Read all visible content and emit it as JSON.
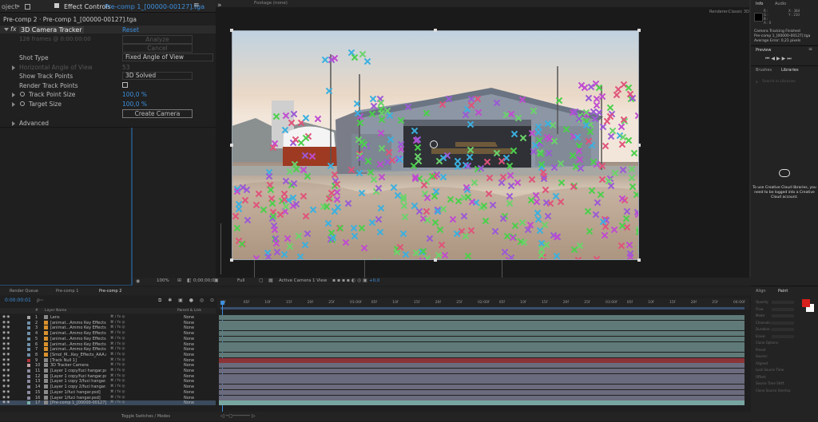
{
  "left_panel": {
    "project_tab": "oject",
    "effect_controls_label": "Effect Controls",
    "effect_controls_comp": "Pre-comp 1_[00000-00127].tga",
    "menu_glyph": "≡",
    "breadcrumb": "Pre-comp 2 · Pre-comp 1_[00000-00127].tga",
    "fx": "fx",
    "effect_name": "3D Camera Tracker",
    "reset": "Reset",
    "frames_info": "128 frames @ 0:00:00:00",
    "analyze_btn": "Analyze",
    "cancel_btn": "Cancel",
    "rows": [
      {
        "label": "Shot Type",
        "value": "Fixed Angle of View"
      },
      {
        "label": "Horizontal Angle of View",
        "value": "53"
      },
      {
        "label": "Show Track Points",
        "value": "3D Solved"
      },
      {
        "label": "Render Track Points",
        "value": ""
      },
      {
        "label": "Track Point Size",
        "value": "100,0 %"
      },
      {
        "label": "Target Size",
        "value": "100,0 %"
      }
    ],
    "create_camera": "Create Camera",
    "advanced": "Advanced"
  },
  "viewer": {
    "footage_tab": "Footage (none)",
    "renderer_label": "Renderer:",
    "renderer_value": "Classic 3D",
    "toolbar": {
      "zoom": "100%",
      "timecode": "0;00;00;01",
      "quality": "Full",
      "camera": "Active Camera",
      "views": "1 View",
      "offset": "+0,0"
    }
  },
  "info_panel": {
    "tab_info": "Info",
    "tab_audio": "Audio",
    "r": "R :",
    "g": "G :",
    "b": "B :",
    "a": "A : 0",
    "x": "X : 384",
    "y": "Y : 210",
    "status_lines": [
      "Camera Tracking Finished",
      "Pre-comp 1_[00000-00127].tga",
      "Average Error: 0,21 pixels"
    ]
  },
  "preview_panel": {
    "title": "Preview",
    "menu": "≡"
  },
  "libraries_panel": {
    "tab_brushes": "Brushes",
    "tab_libraries": "Libraries",
    "search_placeholder": "Search in Libraries",
    "message": "To use Creative Cloud libraries, you need to be logged into a Creative Cloud account."
  },
  "paint_panel": {
    "tab_align": "Align",
    "tab_paint": "Paint",
    "fields": [
      "Opacity:",
      "Flow:",
      "Mode:",
      "Channels:",
      "Duration:",
      "Erase:",
      "Clone Options",
      "Preset",
      "Source:",
      "Aligned",
      "Lock Source Time",
      "Offset:",
      "Source Time Shift:",
      "Clone Source Overlay:"
    ],
    "fg_color": "#d8201c",
    "bg_color": "#ffffff"
  },
  "timeline": {
    "tabs": [
      "Render Queue",
      "Pre-comp 1",
      "Pre-comp 2"
    ],
    "timecode": "0:00:00:01",
    "search_placeholder": "ρ~",
    "columns": {
      "num": "#",
      "source": "Layer Name",
      "parent": "Parent & Link"
    },
    "ruler": [
      "0f",
      "05f",
      "10f",
      "15f",
      "20f",
      "25f",
      "01:00f",
      "05f",
      "10f",
      "15f",
      "20f",
      "25f",
      "02:00f",
      "05f",
      "10f",
      "15f",
      "20f",
      "25f",
      "03:00f",
      "05f",
      "10f",
      "15f",
      "20f",
      "25f",
      "04:00f"
    ],
    "layers": [
      {
        "num": "1",
        "name": "Lens",
        "parent": "None",
        "color": "#a5a5a5"
      },
      {
        "num": "2",
        "name": "[animat...Ammo Key Effects.mp4]",
        "parent": "None",
        "color": "#6f8fa8"
      },
      {
        "num": "3",
        "name": "[animat...Ammo Key Effects.mp4]",
        "parent": "None",
        "color": "#6f8fa8"
      },
      {
        "num": "4",
        "name": "[animat...Ammo Key Effects.mp4]",
        "parent": "None",
        "color": "#6f8fa8"
      },
      {
        "num": "5",
        "name": "[animat...Ammo Key Effects.mp4]",
        "parent": "None",
        "color": "#6f8fa8"
      },
      {
        "num": "6",
        "name": "[animat...Ammo Key Effects.mp4]",
        "parent": "None",
        "color": "#6f8fa8"
      },
      {
        "num": "7",
        "name": "[animat...Ammo Key Effects.mp4]",
        "parent": "None",
        "color": "#6f8fa8"
      },
      {
        "num": "8",
        "name": "[Smol_M...Key_Effects_AAA.mp4]",
        "parent": "None",
        "color": "#6f8fa8"
      },
      {
        "num": "9",
        "name": "[Track Null 1]",
        "parent": "None",
        "color": "#b5333a"
      },
      {
        "num": "10",
        "name": "3D Tracker Camera",
        "parent": "None",
        "color": "#c4a4a8"
      },
      {
        "num": "11",
        "name": "[Layer 1 copy/fuci hangar.psd]",
        "parent": "None",
        "color": "#8a8aa0"
      },
      {
        "num": "12",
        "name": "[Layer 1 copy/fuci hangar.psd]",
        "parent": "None",
        "color": "#8a8aa0"
      },
      {
        "num": "13",
        "name": "[Layer 1 copy 3/fuci hangar.psd]",
        "parent": "None",
        "color": "#8a8aa0"
      },
      {
        "num": "14",
        "name": "[Layer 1 copy 2/fuci hangar.psd]",
        "parent": "None",
        "color": "#8a8aa0"
      },
      {
        "num": "15",
        "name": "[Layer 1/fuci hangar.psd]",
        "parent": "None",
        "color": "#8a8aa0"
      },
      {
        "num": "16",
        "name": "[Layer 1/fuci hangar.psd]",
        "parent": "None",
        "color": "#8a8aa0"
      },
      {
        "num": "17",
        "name": "[Pre-comp 1_[00000-00127].tga]",
        "parent": "None",
        "color": "#7ab0a8"
      }
    ],
    "footer": "Toggle Switches / Modes"
  }
}
